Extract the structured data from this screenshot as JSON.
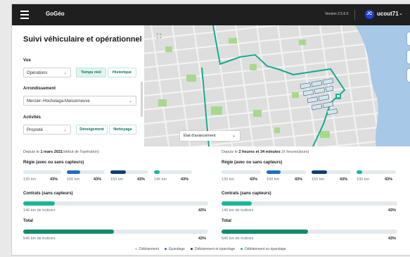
{
  "app": {
    "brand": "GoGéo",
    "version": "Version 2.5.6.0",
    "user_initials": "JC",
    "user": "ucout71"
  },
  "panel": {
    "title": "Suivi véhiculaire et opérationnel",
    "vue_label": "Vue",
    "vue_value": "Opérations",
    "btn_temps_reel": "Temps réel",
    "btn_historique": "Historique",
    "arrondissement_label": "Arrondissement",
    "arrondissement_value": "Mercier–Hochelaga-Maisonneuve",
    "activites_label": "Activités",
    "activites_value": "Propreté",
    "btn_deneigement": "Déneigement",
    "btn_nettoyage": "Nettoyage"
  },
  "map": {
    "etat_label": "État d'avancement"
  },
  "colors": {
    "light": "#d8eef6",
    "blue": "#1e6fc0",
    "navy": "#0d3f6b",
    "teal": "#1bb69a",
    "green": "#168a6c"
  },
  "left": {
    "since_prefix": "Depuis le",
    "since_bold": "1 mars 2021",
    "since_suffix": "(début de l'opération)",
    "regie_title": "Régie (avec ou sans capteurs)",
    "mini": [
      {
        "km": "130 km",
        "pct": "43%",
        "fill": 0.2
      },
      {
        "km": "100 km",
        "pct": "43%",
        "fill": 0.35
      },
      {
        "km": "150 km",
        "pct": "43%",
        "fill": 0.4
      },
      {
        "km": "146 km",
        "pct": "43%",
        "fill": 0.15
      }
    ],
    "contrats_title": "Contrats (sans capteurs)",
    "contrats_label": "146 km de trottoirs",
    "contrats_pct": "43%",
    "contrats_fill": 0.17,
    "total_title": "Total",
    "total_label": "546 km de trottoirs",
    "total_pct": "43%",
    "total_fill": 0.49
  },
  "right": {
    "since_prefix": "Depuis le",
    "since_bold": "2 heures et 34 minutes",
    "since_suffix": "(X heures/jours)",
    "regie_title": "Régie (avec ou sans capteurs)",
    "mini": [
      {
        "km": "130 km",
        "pct": "43%",
        "fill": 0.2
      },
      {
        "km": "100 km",
        "pct": "43%",
        "fill": 0.35
      },
      {
        "km": "150 km",
        "pct": "43%",
        "fill": 0.4
      },
      {
        "km": "100 km",
        "pct": "43%",
        "fill": 0.15
      }
    ],
    "contrats_title": "Contrats (sans capteurs)",
    "contrats_label": "146 km de trottoirs",
    "contrats_pct": "43%",
    "contrats_fill": 0.17,
    "total_title": "Total",
    "total_label": "546 km de trottoirs",
    "total_pct": "43%",
    "total_fill": 0.49
  },
  "legend": [
    {
      "label": "Déblaiement",
      "color": "#d0d0d0"
    },
    {
      "label": "Épandage",
      "color": "#1e6fc0"
    },
    {
      "label": "Déblaiement et épandage",
      "color": "#0d3f6b"
    },
    {
      "label": "Déblaiement ou épandage",
      "color": "#1bb69a"
    }
  ]
}
